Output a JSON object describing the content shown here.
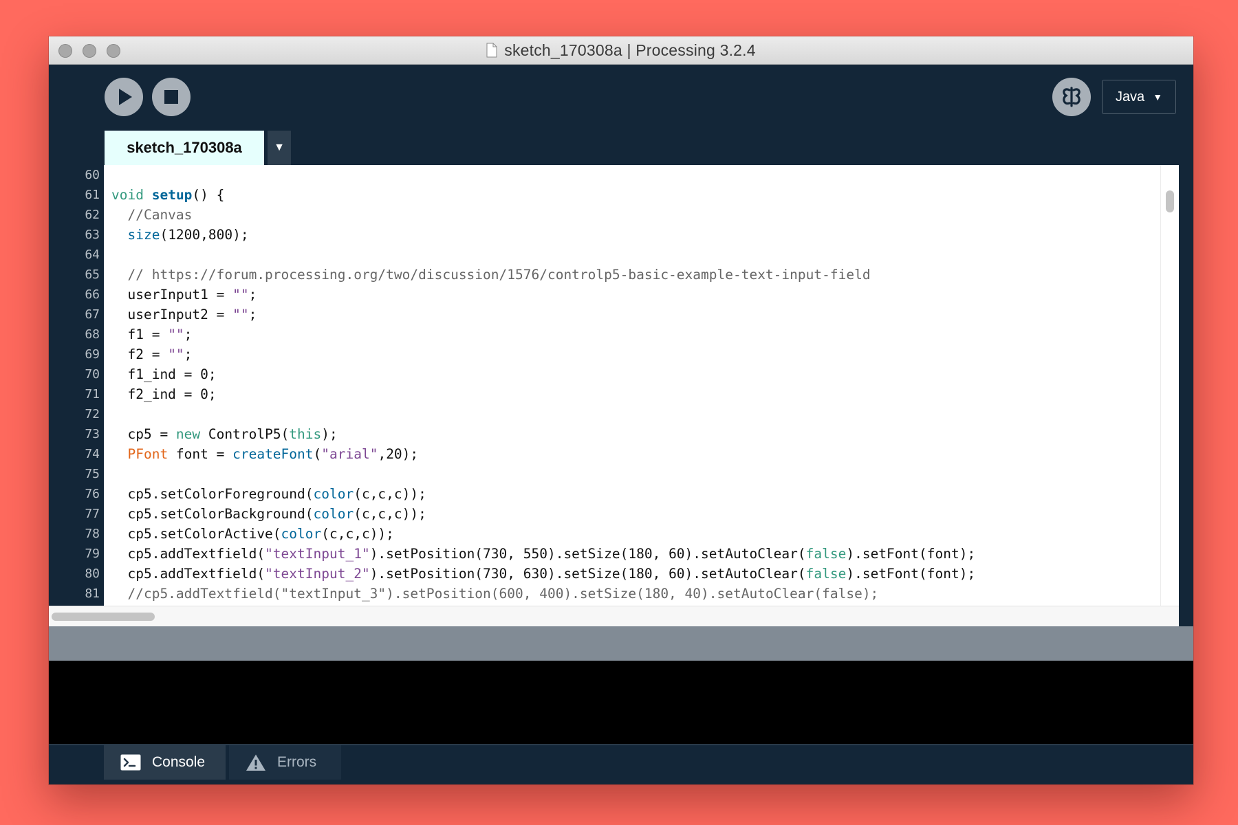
{
  "window": {
    "title": "sketch_170308a | Processing 3.2.4"
  },
  "toolbar": {
    "run_icon": "play-icon",
    "stop_icon": "stop-icon",
    "debug_icon": "debugger-butterfly-icon",
    "mode_label": "Java",
    "mode_caret": "▼"
  },
  "tabs": [
    {
      "label": "sketch_170308a",
      "active": true
    }
  ],
  "tab_menu_caret": "▼",
  "editor": {
    "first_line_number": 60,
    "lines": [
      {
        "n": "60",
        "code": ""
      },
      {
        "n": "61",
        "code": "void setup() {"
      },
      {
        "n": "62",
        "code": "  //Canvas"
      },
      {
        "n": "63",
        "code": "  size(1200,800);"
      },
      {
        "n": "64",
        "code": ""
      },
      {
        "n": "65",
        "code": "  // https://forum.processing.org/two/discussion/1576/controlp5-basic-example-text-input-field"
      },
      {
        "n": "66",
        "code": "  userInput1 = \"\";"
      },
      {
        "n": "67",
        "code": "  userInput2 = \"\";"
      },
      {
        "n": "68",
        "code": "  f1 = \"\";"
      },
      {
        "n": "69",
        "code": "  f2 = \"\";"
      },
      {
        "n": "70",
        "code": "  f1_ind = 0;"
      },
      {
        "n": "71",
        "code": "  f2_ind = 0;"
      },
      {
        "n": "72",
        "code": ""
      },
      {
        "n": "73",
        "code": "  cp5 = new ControlP5(this);"
      },
      {
        "n": "74",
        "code": "  PFont font = createFont(\"arial\",20);"
      },
      {
        "n": "75",
        "code": ""
      },
      {
        "n": "76",
        "code": "  cp5.setColorForeground(color(c,c,c));"
      },
      {
        "n": "77",
        "code": "  cp5.setColorBackground(color(c,c,c));"
      },
      {
        "n": "78",
        "code": "  cp5.setColorActive(color(c,c,c));"
      },
      {
        "n": "79",
        "code": "  cp5.addTextfield(\"textInput_1\").setPosition(730, 550).setSize(180, 60).setAutoClear(false).setFont(font);"
      },
      {
        "n": "80",
        "code": "  cp5.addTextfield(\"textInput_2\").setPosition(730, 630).setSize(180, 60).setAutoClear(false).setFont(font);"
      },
      {
        "n": "81",
        "code": "  //cp5.addTextfield(\"textInput_3\").setPosition(600, 400).setSize(180, 40).setAutoClear(false);"
      }
    ]
  },
  "syntax_colors": {
    "keyword": "#33997e",
    "function": "#006699",
    "string": "#7d4793",
    "comment": "#666666",
    "type": "#e2661a"
  },
  "footer": {
    "console_label": "Console",
    "console_icon": "terminal-icon",
    "errors_label": "Errors",
    "errors_icon": "warning-icon"
  }
}
